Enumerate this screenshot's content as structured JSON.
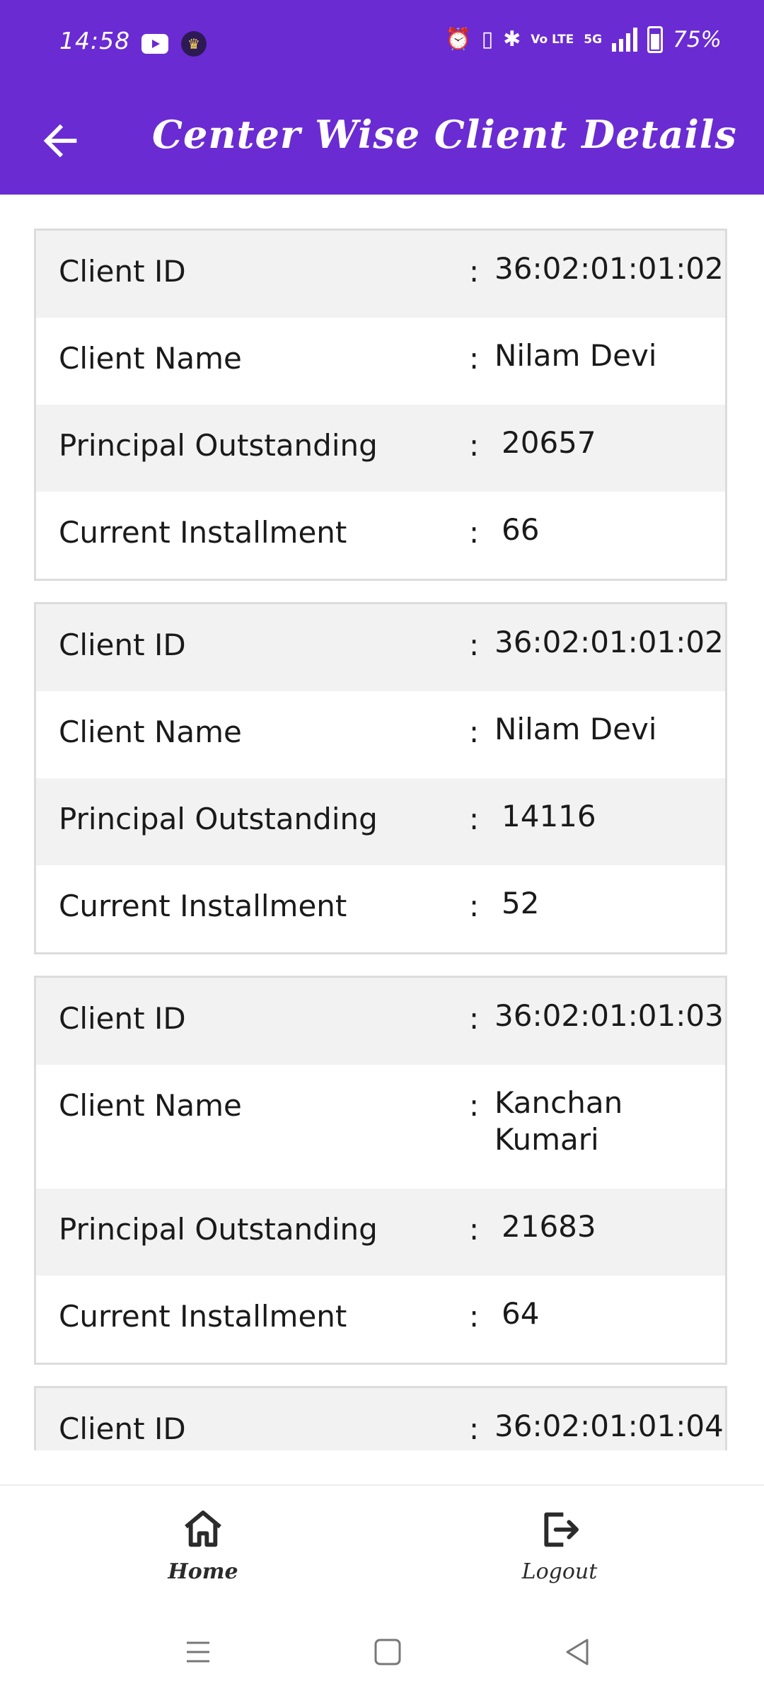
{
  "status_bar": {
    "time": "14:58",
    "battery": "75%",
    "network": "5G",
    "volte": "Vo LTE",
    "icons": [
      "youtube-icon",
      "crown-icon",
      "alarm-icon",
      "vibrate-icon",
      "bluetooth-icon",
      "volte-icon",
      "signal-icon",
      "battery-icon"
    ]
  },
  "app_bar": {
    "title": "Center Wise Client Details",
    "back_icon": "arrow-left-icon"
  },
  "labels": {
    "client_id": "Client ID",
    "client_name": "Client Name",
    "principal_outstanding": "Principal Outstanding",
    "current_installment": "Current Installment",
    "separator": ":"
  },
  "clients": [
    {
      "client_id": "36:02:01:01:02",
      "client_name": "Nilam Devi",
      "principal_outstanding": "20657",
      "current_installment": "66"
    },
    {
      "client_id": "36:02:01:01:02",
      "client_name": "Nilam Devi",
      "principal_outstanding": "14116",
      "current_installment": "52"
    },
    {
      "client_id": "36:02:01:01:03",
      "client_name": "Kanchan Kumari",
      "principal_outstanding": "21683",
      "current_installment": "64"
    },
    {
      "client_id": "36:02:01:01:04"
    }
  ],
  "bottom_nav": {
    "home_label": "Home",
    "logout_label": "Logout"
  },
  "colors": {
    "primary": "#6a2bd3",
    "row_alt": "#f2f2f2",
    "border": "#dcdcdc"
  }
}
